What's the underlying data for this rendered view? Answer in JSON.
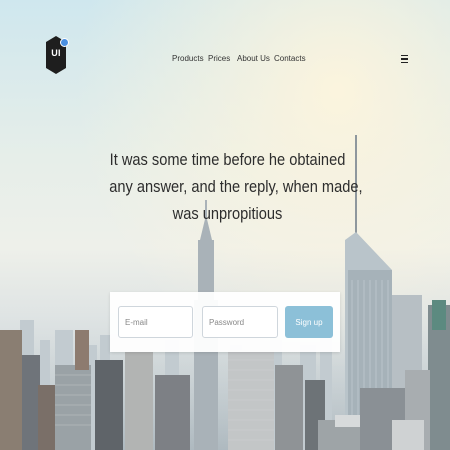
{
  "brand": {
    "logo_text": "UI"
  },
  "nav": {
    "items": [
      {
        "label": "Products"
      },
      {
        "label": "Prices"
      },
      {
        "label": "About Us"
      },
      {
        "label": "Contacts"
      }
    ]
  },
  "hero": {
    "headline_lines": [
      "It was some time before he obtained",
      "any answer, and the reply, when made,",
      "was unpropitious"
    ]
  },
  "signup_form": {
    "email_placeholder": "E-mail",
    "password_placeholder": "Password",
    "submit_label": "Sign up"
  },
  "colors": {
    "accent": "#8cc0d8",
    "logo_bg": "#1e1e1e",
    "logo_dot": "#4a8fe0"
  }
}
